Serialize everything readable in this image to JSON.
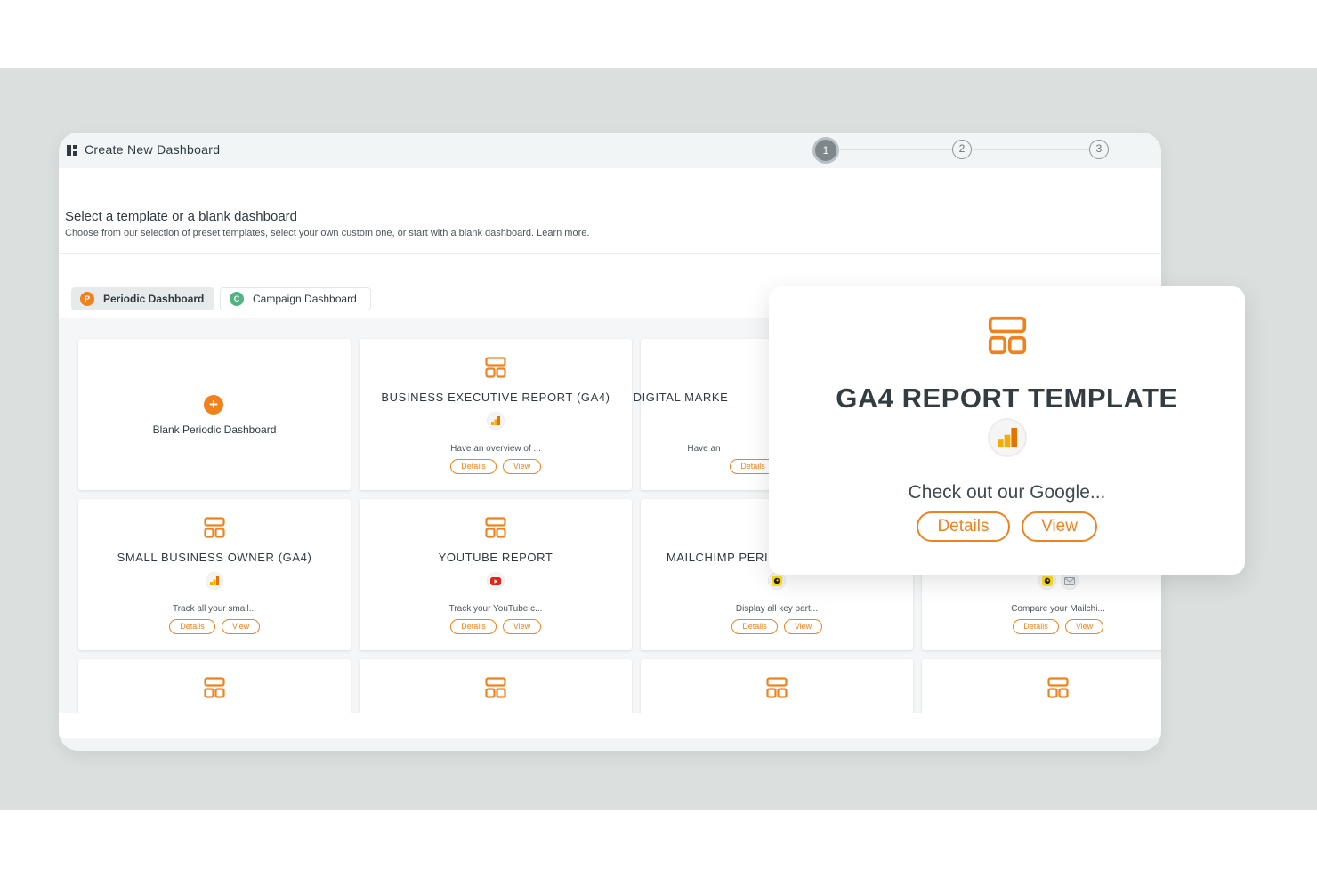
{
  "colors": {
    "accent": "#f0821e",
    "backdrop": "#dbe0df",
    "text": "#2e3a40",
    "badge_periodic": "#f0821e",
    "badge_campaign": "#4fb383"
  },
  "window": {
    "title": "Create New Dashboard",
    "title_icon": "dashboard-grid-icon"
  },
  "stepper": {
    "steps": [
      "1",
      "2",
      "3"
    ],
    "active_step": 1
  },
  "header": {
    "heading": "Select a template or a blank dashboard",
    "subheading": "Choose from our selection of preset templates, select your own custom one, or start with a blank dashboard. Learn more."
  },
  "tabs": [
    {
      "badge": "P",
      "label": "Periodic Dashboard",
      "active": true
    },
    {
      "badge": "C",
      "label": "Campaign Dashboard",
      "active": false
    }
  ],
  "blank_card": {
    "label": "Blank Periodic Dashboard",
    "icon": "plus-icon"
  },
  "cards": [
    {
      "title": "BUSINESS EXECUTIVE REPORT (GA4)",
      "source_icons": [
        "google-analytics-icon"
      ],
      "description": "Have an overview of ...",
      "details": "Details",
      "view": "View"
    },
    {
      "title": "DIGITAL MARKE",
      "source_icons": [],
      "description": "Have an",
      "details": "Details",
      "view": ""
    },
    {
      "title": "SMALL BUSINESS OWNER (GA4)",
      "source_icons": [
        "google-analytics-icon"
      ],
      "description": "Track all your small...",
      "details": "Details",
      "view": "View"
    },
    {
      "title": "YOUTUBE REPORT",
      "source_icons": [
        "youtube-icon"
      ],
      "description": "Track your YouTube c...",
      "details": "Details",
      "view": "View"
    },
    {
      "title": "MAILCHIMP PERI",
      "source_icons": [
        "mailchimp-icon"
      ],
      "description": "Display all key part...",
      "details": "Details",
      "view": "View"
    },
    {
      "title": "",
      "source_icons": [
        "mailchimp-icon",
        "email-icon"
      ],
      "description": "Compare your Mailchi...",
      "details": "Details",
      "view": "View"
    }
  ],
  "popup": {
    "icon": "template-layout-icon",
    "title": "GA4 REPORT TEMPLATE",
    "source_icon": "google-analytics-icon",
    "description": "Check out our Google...",
    "details": "Details",
    "view": "View"
  }
}
